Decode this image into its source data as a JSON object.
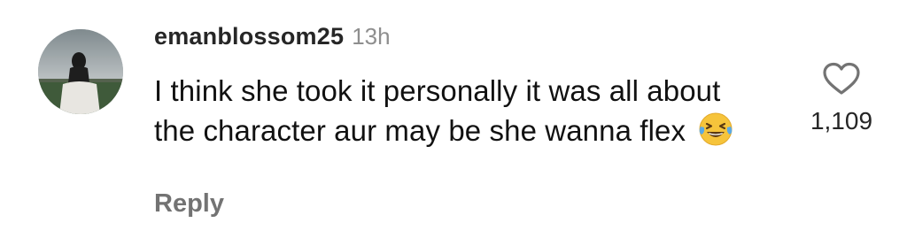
{
  "comment": {
    "username": "emanblossom25",
    "time": "13h",
    "text": "I think she took it personally it was all about the character aur may be she wanna flex",
    "emoji": "face-with-tears-of-joy",
    "reply_label": "Reply",
    "like_count": "1,109",
    "icons": {
      "like": "heart-outline-icon",
      "avatar": "profile-photo"
    }
  }
}
